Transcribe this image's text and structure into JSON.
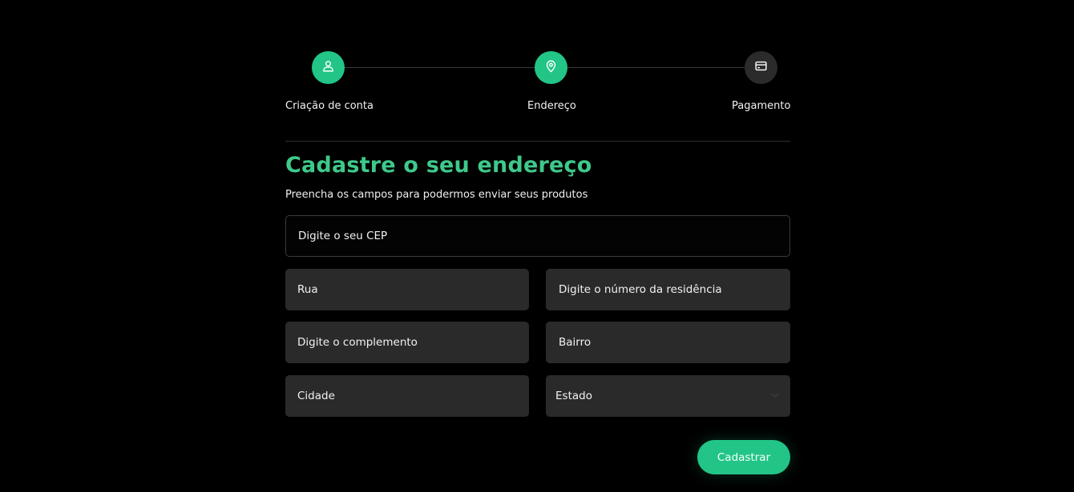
{
  "stepper": {
    "steps": [
      {
        "label": "Criação de conta",
        "icon": "user-icon",
        "state": "active"
      },
      {
        "label": "Endereço",
        "icon": "location-pin-icon",
        "state": "active"
      },
      {
        "label": "Pagamento",
        "icon": "credit-card-icon",
        "state": "inactive"
      }
    ]
  },
  "form": {
    "title": "Cadastre o seu endereço",
    "subtitle": "Preencha os campos para podermos enviar seus produtos",
    "cep_placeholder": "Digite o seu CEP",
    "rua_placeholder": "Rua",
    "numero_placeholder": "Digite o número da residência",
    "complemento_placeholder": "Digite o complemento",
    "bairro_placeholder": "Bairro",
    "cidade_placeholder": "Cidade",
    "estado_selected": "Estado",
    "submit_label": "Cadastrar"
  },
  "colors": {
    "accent": "#22c586",
    "title": "#3ec98a",
    "background": "#000000",
    "field_bg": "#2a2a2a"
  }
}
